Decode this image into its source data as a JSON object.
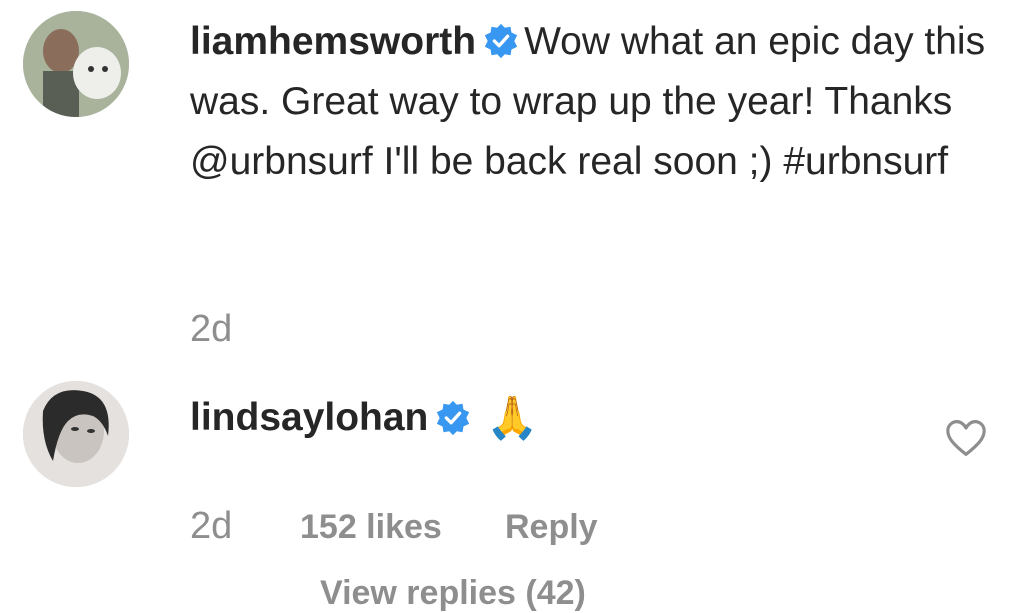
{
  "comments": [
    {
      "username": "liamhemsworth",
      "text_before": "Wow what an epic day this was. Great way to wrap up the year! Thanks ",
      "mention": "@urbnsurf",
      "text_after": " I'll be back real soon ;) ",
      "hashtag": "#urbnsurf",
      "timestamp": "2d"
    },
    {
      "username": "lindsaylohan",
      "text": "🙏",
      "timestamp": "2d",
      "likes": "152 likes",
      "reply_label": "Reply",
      "view_replies": "View replies (42)"
    }
  ],
  "colors": {
    "verified": "#3897f0",
    "secondary_text": "#8e8e8e",
    "primary_text": "#262626"
  },
  "icons": [
    "verified-badge-icon",
    "heart-icon"
  ]
}
